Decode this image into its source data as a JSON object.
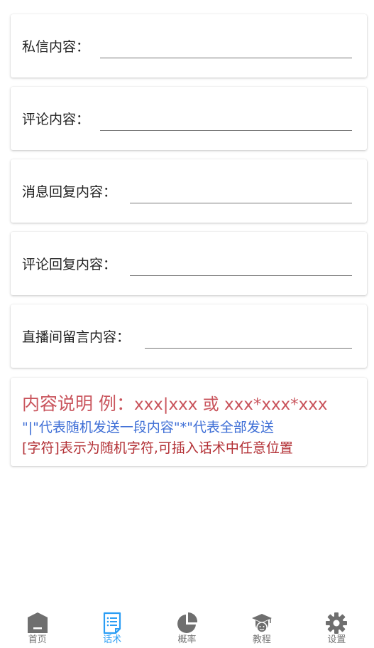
{
  "fields": [
    {
      "label": "私信内容：",
      "value": ""
    },
    {
      "label": "评论内容：",
      "value": ""
    },
    {
      "label": "消息回复内容：",
      "value": ""
    },
    {
      "label": "评论回复内容：",
      "value": ""
    },
    {
      "label": "直播间留言内容：",
      "value": ""
    }
  ],
  "note": {
    "title": "内容说明 例：",
    "example": "xxx|xxx 或 xxx*xxx*xxx",
    "line2": "\"|\"代表随机发送一段内容\"*\"代表全部发送",
    "line3": "[字符]表示为随机字符,可插入话术中任意位置",
    "colors": {
      "title": "#c9545c",
      "line2": "#3f6fd6",
      "line3": "#b33136"
    }
  },
  "tabbar": {
    "active_color": "#2a9df4",
    "inactive_color": "#777777",
    "tabs": [
      {
        "label": "首页",
        "icon": "home-icon",
        "active": false
      },
      {
        "label": "话术",
        "icon": "script-document-icon",
        "active": true
      },
      {
        "label": "概率",
        "icon": "pie-chart-icon",
        "active": false
      },
      {
        "label": "教程",
        "icon": "graduation-cap-icon",
        "active": false
      },
      {
        "label": "设置",
        "icon": "gear-icon",
        "active": false
      }
    ]
  }
}
